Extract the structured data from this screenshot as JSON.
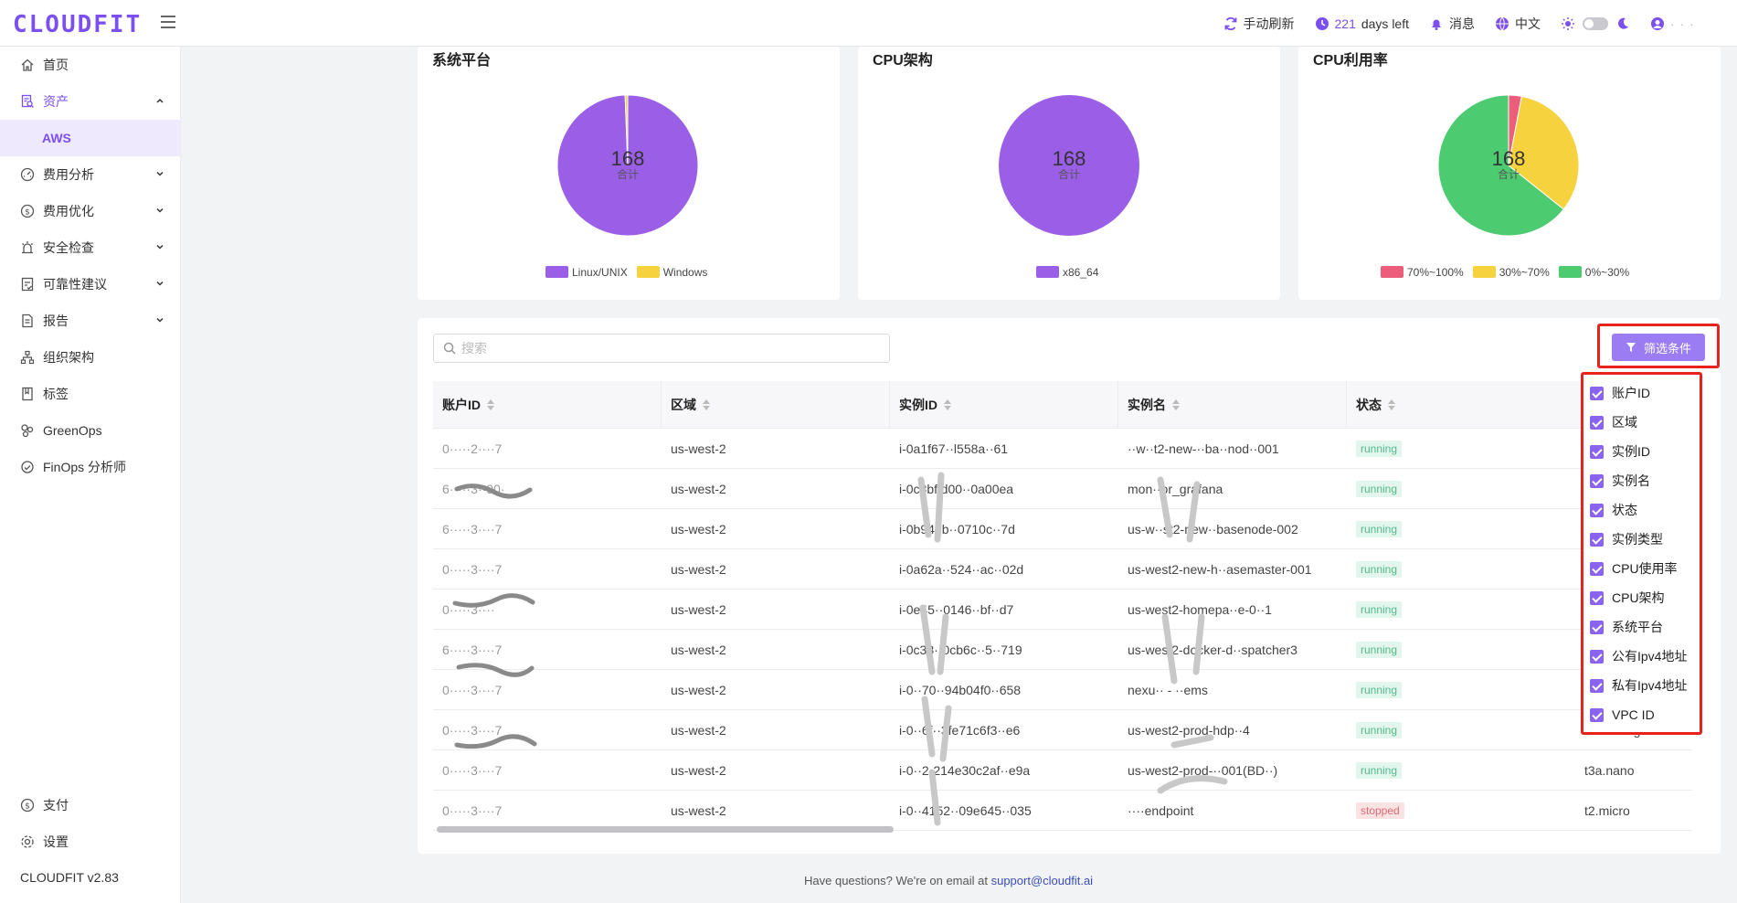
{
  "header": {
    "logo": "CLOUDFIT",
    "refresh_label": "手动刷新",
    "days_count": "221",
    "days_suffix": "days left",
    "messages_label": "消息",
    "language_label": "中文",
    "user_name": "· · ·"
  },
  "sidebar": {
    "items": [
      {
        "label": "首页",
        "icon": "home-icon"
      },
      {
        "label": "资产",
        "icon": "asset-icon"
      },
      {
        "label": "AWS"
      },
      {
        "label": "费用分析",
        "icon": "gauge-icon"
      },
      {
        "label": "费用优化",
        "icon": "dollar-icon"
      },
      {
        "label": "安全检查",
        "icon": "alarm-icon"
      },
      {
        "label": "可靠性建议",
        "icon": "doc-check-icon"
      },
      {
        "label": "报告",
        "icon": "report-icon"
      },
      {
        "label": "组织架构",
        "icon": "org-icon"
      },
      {
        "label": "标签",
        "icon": "tag-icon"
      },
      {
        "label": "GreenOps",
        "icon": "leaf-icon"
      },
      {
        "label": "FinOps 分析师",
        "icon": "analyst-icon"
      },
      {
        "label": "支付",
        "icon": "dollar-icon"
      },
      {
        "label": "设置",
        "icon": "gear-icon"
      }
    ],
    "version": "CLOUDFIT v2.83"
  },
  "cards": [
    {
      "title": "系统平台",
      "total": "168",
      "total_label": "合计",
      "legend": [
        {
          "label": "Linux/UNIX",
          "color": "#9a5fe6"
        },
        {
          "label": "Windows",
          "color": "#f6d33e"
        }
      ]
    },
    {
      "title": "CPU架构",
      "total": "168",
      "total_label": "合计",
      "legend": [
        {
          "label": "x86_64",
          "color": "#9a5fe6"
        }
      ]
    },
    {
      "title": "CPU利用率",
      "total": "168",
      "total_label": "合计",
      "legend": [
        {
          "label": "70%~100%",
          "color": "#eb5d7a"
        },
        {
          "label": "30%~70%",
          "color": "#f6d33e"
        },
        {
          "label": "0%~30%",
          "color": "#4ccb70"
        }
      ]
    }
  ],
  "chart_data": [
    {
      "type": "pie",
      "title": "系统平台",
      "categories": [
        "Linux/UNIX",
        "Windows"
      ],
      "values": [
        167,
        1
      ],
      "colors": [
        "#9a5fe6",
        "#f6d33e"
      ]
    },
    {
      "type": "pie",
      "title": "CPU架构",
      "categories": [
        "x86_64"
      ],
      "values": [
        168
      ],
      "colors": [
        "#9a5fe6"
      ]
    },
    {
      "type": "pie",
      "title": "CPU利用率",
      "categories": [
        "70%~100%",
        "30%~70%",
        "0%~30%"
      ],
      "values": [
        5,
        55,
        108
      ],
      "colors": [
        "#eb5d7a",
        "#f6d33e",
        "#4ccb70"
      ]
    }
  ],
  "table": {
    "search_placeholder": "搜索",
    "filter_label": "筛选条件",
    "columns": [
      "账户ID",
      "区域",
      "实例ID",
      "实例名",
      "状态"
    ],
    "rows": [
      {
        "account": "0·····2····7",
        "region": "us-west-2",
        "instance_id": "i-0a1f67··l558a··61",
        "name": "··w··t2-new-··ba··nod··001",
        "status": "running",
        "type": ""
      },
      {
        "account": "6·····3··90·",
        "region": "us-west-2",
        "instance_id": "i-0c3bffd00··0a00ea",
        "name": "mon··or_grafana",
        "status": "running",
        "type": ""
      },
      {
        "account": "6·····3····7",
        "region": "us-west-2",
        "instance_id": "i-0b940b··0710c··7d",
        "name": "us-w··st2-new··basenode-002",
        "status": "running",
        "type": ""
      },
      {
        "account": "0·····3····7",
        "region": "us-west-2",
        "instance_id": "i-0a62a··524··ac··02d",
        "name": "us-west2-new-h··asemaster-001",
        "status": "running",
        "type": ""
      },
      {
        "account": "0·····3····",
        "region": "us-west-2",
        "instance_id": "i-0e45··0146··bf··d7",
        "name": "us-west2-homepa··e-0··1",
        "status": "running",
        "type": ""
      },
      {
        "account": "6·····3····7",
        "region": "us-west-2",
        "instance_id": "i-0c38··0cb6c··5··719",
        "name": "us-west2-docker-d··spatcher3",
        "status": "running",
        "type": ""
      },
      {
        "account": "0·····3····7",
        "region": "us-west-2",
        "instance_id": "i-0··70··94b04f0··658",
        "name": "nexu·· - ··ems",
        "status": "running",
        "type": ""
      },
      {
        "account": "0·····3····7",
        "region": "us-west-2",
        "instance_id": "i-0··6f··3fe71c6f3··e6",
        "name": "us-west2-prod-hdp··4",
        "status": "running",
        "type": "m5.4xlarge"
      },
      {
        "account": "0·····3····7",
        "region": "us-west-2",
        "instance_id": "i-0··2·214e30c2af··e9a",
        "name": "us-west2-prod-··001(BD··)",
        "status": "running",
        "type": "t3a.nano"
      },
      {
        "account": "0·····3····7",
        "region": "us-west-2",
        "instance_id": "i-0··4152··09e645··035",
        "name": "····endpoint",
        "status": "stopped",
        "type": "t2.micro"
      }
    ]
  },
  "column_picker": [
    {
      "label": "账户ID",
      "checked": true
    },
    {
      "label": "区域",
      "checked": true
    },
    {
      "label": "实例ID",
      "checked": true
    },
    {
      "label": "实例名",
      "checked": true
    },
    {
      "label": "状态",
      "checked": true
    },
    {
      "label": "实例类型",
      "checked": true
    },
    {
      "label": "CPU使用率",
      "checked": true
    },
    {
      "label": "CPU架构",
      "checked": true
    },
    {
      "label": "系统平台",
      "checked": true
    },
    {
      "label": "公有Ipv4地址",
      "checked": true
    },
    {
      "label": "私有Ipv4地址",
      "checked": true
    },
    {
      "label": "VPC ID",
      "checked": true
    }
  ],
  "footer": {
    "text": "Have questions? We're on email at",
    "email": "support@cloudfit.ai"
  },
  "colors": {
    "accent": "#7b4ff0",
    "highlight": "#e8221d"
  }
}
